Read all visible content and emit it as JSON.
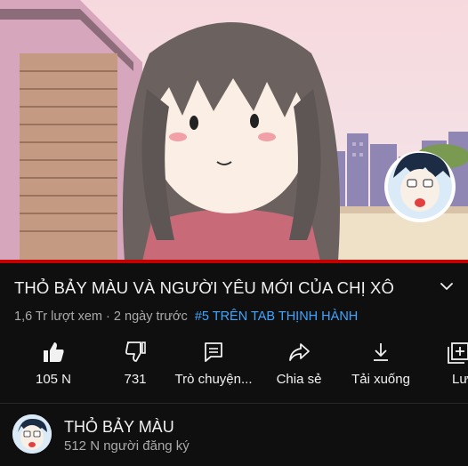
{
  "video": {
    "title": "THỎ BẢY MÀU VÀ NGƯỜI YÊU MỚI CỦA CHỊ XÔ",
    "views": "1,6 Tr lượt xem",
    "separator": "·",
    "uploaded": "2 ngày trước",
    "hashtag": "#5 TRÊN TAB THỊNH HÀNH",
    "progress": 1.0
  },
  "actions": [
    {
      "label": "105 N",
      "icon": "thumbs-up-filled-icon"
    },
    {
      "label": "731",
      "icon": "thumbs-down-icon"
    },
    {
      "label": "Trò chuyện...",
      "icon": "chat-icon"
    },
    {
      "label": "Chia sẻ",
      "icon": "share-icon"
    },
    {
      "label": "Tải xuống",
      "icon": "download-icon"
    },
    {
      "label": "Lưu",
      "icon": "save-playlist-icon"
    }
  ],
  "channel": {
    "name": "THỎ BẢY MÀU",
    "subscribers": "512 N người đăng ký"
  },
  "colors": {
    "background": "#0f0f0f",
    "hashtag": "#3ea6ff",
    "progress": "#c20000",
    "secondary_text": "#aaaaaa"
  }
}
